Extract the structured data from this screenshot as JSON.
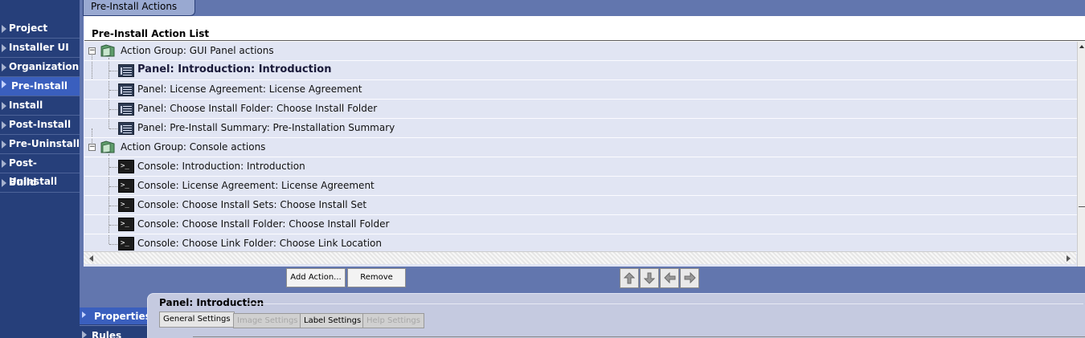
{
  "nav": {
    "items": [
      {
        "label": "Project",
        "active": false
      },
      {
        "label": "Installer UI",
        "active": false
      },
      {
        "label": "Organization",
        "active": false
      },
      {
        "label": "Pre-Install",
        "active": true
      },
      {
        "label": "Install",
        "active": false
      },
      {
        "label": "Post-Install",
        "active": false
      },
      {
        "label": "Pre-Uninstall",
        "active": false
      },
      {
        "label": "Post-Uninstall",
        "active": false
      },
      {
        "label": "Build",
        "active": false
      }
    ]
  },
  "top_tab": {
    "label": "Pre-Install Actions"
  },
  "list": {
    "title": "Pre-Install Action List",
    "rows": [
      {
        "kind": "group",
        "label": "Action Group: GUI Panel actions",
        "icon": "folder-icon"
      },
      {
        "kind": "panel",
        "label": "Panel: Introduction: Introduction",
        "selected": true,
        "icon": "panel-icon"
      },
      {
        "kind": "panel",
        "label": "Panel: License Agreement: License Agreement",
        "icon": "panel-icon"
      },
      {
        "kind": "panel",
        "label": "Panel: Choose Install Folder: Choose Install Folder",
        "icon": "panel-icon"
      },
      {
        "kind": "panel",
        "label": "Panel: Pre-Install Summary: Pre-Installation Summary",
        "icon": "panel-icon"
      },
      {
        "kind": "group",
        "label": "Action Group: Console actions",
        "icon": "folder-icon"
      },
      {
        "kind": "console",
        "label": "Console: Introduction: Introduction",
        "icon": "console-icon"
      },
      {
        "kind": "console",
        "label": "Console: License Agreement: License Agreement",
        "icon": "console-icon"
      },
      {
        "kind": "console",
        "label": "Console: Choose Install Sets: Choose Install Set",
        "icon": "console-icon"
      },
      {
        "kind": "console",
        "label": "Console: Choose Install Folder: Choose Install Folder",
        "icon": "console-icon"
      },
      {
        "kind": "console",
        "label": "Console: Choose Link Folder: Choose Link Location",
        "icon": "console-icon"
      }
    ]
  },
  "buttons": {
    "add_action": "Add Action...",
    "remove": "Remove",
    "arrows": [
      "arrow-up-icon",
      "arrow-down-icon",
      "arrow-left-icon",
      "arrow-right-icon"
    ]
  },
  "bottom": {
    "properties_label": "Properties",
    "rules_label": "Rules",
    "detail_title": "Panel: Introduction",
    "subtabs": [
      {
        "label": "General Settings",
        "state": "active"
      },
      {
        "label": "Image Settings",
        "state": "disabled"
      },
      {
        "label": "Label Settings",
        "state": "normal"
      },
      {
        "label": "Help Settings",
        "state": "disabled"
      }
    ]
  },
  "colors": {
    "nav_bg": "#263f7a",
    "nav_active": "#3a5fbe",
    "workspace_bg": "#6276ae",
    "tree_row_bg": "#e1e5f3",
    "tab_bg": "#99a9d1"
  }
}
